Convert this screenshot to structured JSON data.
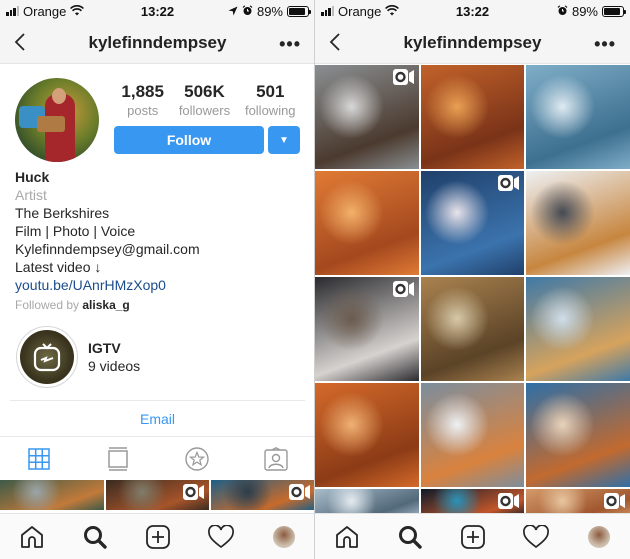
{
  "status_bar": {
    "left": {
      "carrier": "Orange",
      "time": "13:22",
      "battery": "89%",
      "battery_level": 0.89,
      "icons": [
        "signal-icon",
        "wifi-icon",
        "location-icon",
        "alarm-icon",
        "battery-icon"
      ]
    },
    "right": {
      "carrier": "Orange",
      "time": "13:22",
      "battery": "89%",
      "battery_level": 0.89,
      "icons": [
        "signal-icon",
        "wifi-icon",
        "alarm-icon",
        "battery-icon"
      ]
    }
  },
  "header": {
    "username": "kylefinndempsey",
    "back_icon": "chevron-left-icon",
    "more_label": "•••"
  },
  "profile": {
    "stats": [
      {
        "value": "1,885",
        "label": "posts"
      },
      {
        "value": "506K",
        "label": "followers"
      },
      {
        "value": "501",
        "label": "following"
      }
    ],
    "follow_label": "Follow",
    "dropdown_label": "▼",
    "name": "Huck",
    "category": "Artist",
    "bio_lines": [
      "The Berkshires",
      "Film | Photo | Voice",
      "Kylefinndempsey@gmail.com",
      "Latest video ↓"
    ],
    "link": "youtu.be/UAnrHMzXop0",
    "followed_by_prefix": "Followed by",
    "followed_by_user": "aliska_g"
  },
  "highlight": {
    "title": "IGTV",
    "subtitle": "9 videos"
  },
  "email_label": "Email",
  "profile_tabs": [
    {
      "icon": "grid-icon",
      "active": true
    },
    {
      "icon": "feed-icon",
      "active": false
    },
    {
      "icon": "star-icon",
      "active": false
    },
    {
      "icon": "tagged-icon",
      "active": false
    }
  ],
  "accent_color": "#3897f0",
  "posts": [
    {
      "desc": "snowy cabin with hiker",
      "video": true,
      "colors": [
        "#8a8f92",
        "#4b3a2e",
        "#d8d8d8"
      ]
    },
    {
      "desc": "log cabin interior with stove",
      "video": false,
      "colors": [
        "#c2622a",
        "#7a3318",
        "#e9a053"
      ]
    },
    {
      "desc": "aerial frosted forest",
      "video": false,
      "colors": [
        "#7faec8",
        "#3d6f8f",
        "#dfeaf1"
      ]
    },
    {
      "desc": "spiral staircase A-frame",
      "video": false,
      "colors": [
        "#e07b35",
        "#a4481e",
        "#f3b06a"
      ]
    },
    {
      "desc": "campfire in snowy woods",
      "video": true,
      "colors": [
        "#20406a",
        "#3b73ad",
        "#e9e3ea"
      ]
    },
    {
      "desc": "snowy chalet with truck",
      "video": false,
      "colors": [
        "#eef0f3",
        "#c7863f",
        "#444a55"
      ]
    },
    {
      "desc": "husky dogs",
      "video": true,
      "colors": [
        "#2a2a2e",
        "#d6d2cf",
        "#6b5b4e"
      ]
    },
    {
      "desc": "cozy cabin with red mug",
      "video": false,
      "colors": [
        "#a9824f",
        "#5b4327",
        "#d8c9a8"
      ]
    },
    {
      "desc": "lit treehouse in snow",
      "video": false,
      "colors": [
        "#3f79a8",
        "#d6a35d",
        "#cfdeea"
      ]
    },
    {
      "desc": "cabin interior spiral stair",
      "video": false,
      "colors": [
        "#d46a2a",
        "#8c3b16",
        "#f0b173"
      ]
    },
    {
      "desc": "A-frame treehouse in snow",
      "video": false,
      "colors": [
        "#7c8e9e",
        "#d9823e",
        "#eef1f4"
      ]
    },
    {
      "desc": "porch with lights and snow",
      "video": false,
      "colors": [
        "#2f6fa7",
        "#c26a2f",
        "#e9d3bb"
      ]
    }
  ],
  "left_partial_posts": [
    {
      "desc": "A-frame in woods",
      "video": false,
      "colors": [
        "#3d5a48",
        "#c27a3a",
        "#9aa5a8"
      ]
    },
    {
      "desc": "cabin interior",
      "video": true,
      "colors": [
        "#3b2b20",
        "#a7542a",
        "#7f7d6b"
      ]
    },
    {
      "desc": "orange branches blue sky",
      "video": true,
      "colors": [
        "#1f5f86",
        "#c86b2b",
        "#2b3d4c"
      ]
    }
  ],
  "right_partial_posts": [
    {
      "desc": "frosted pines",
      "video": false,
      "colors": [
        "#a8bccb",
        "#52697a",
        "#e5ecf1"
      ]
    },
    {
      "desc": "starry night",
      "video": true,
      "colors": [
        "#0e1a2a",
        "#c2562a",
        "#2a93b9"
      ]
    },
    {
      "desc": "warm close-up",
      "video": true,
      "colors": [
        "#d49a6a",
        "#a0562e",
        "#e8c6a0"
      ]
    }
  ],
  "bottom_nav": [
    {
      "icon": "home-icon"
    },
    {
      "icon": "search-icon",
      "active": true
    },
    {
      "icon": "add-post-icon"
    },
    {
      "icon": "heart-icon"
    },
    {
      "icon": "profile-avatar"
    }
  ]
}
